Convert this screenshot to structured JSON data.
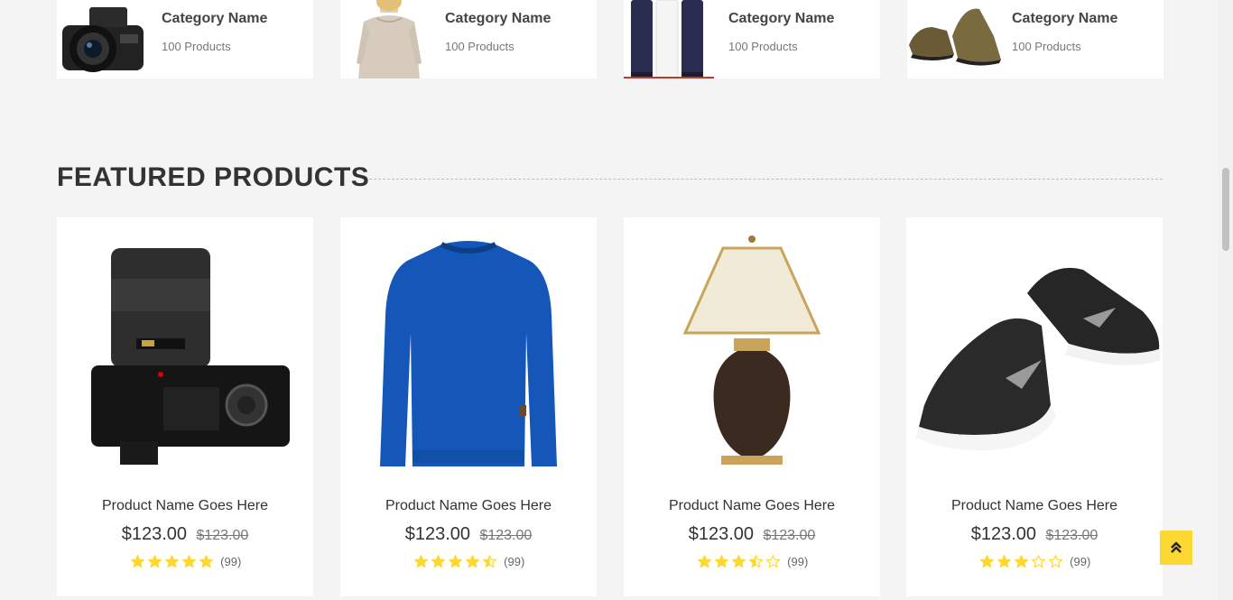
{
  "categories": [
    {
      "name": "Category Name",
      "count": "100 Products",
      "icon": "camera"
    },
    {
      "name": "Category Name",
      "count": "100 Products",
      "icon": "woman-sweater"
    },
    {
      "name": "Category Name",
      "count": "100 Products",
      "icon": "cosmetics"
    },
    {
      "name": "Category Name",
      "count": "100 Products",
      "icon": "shoes"
    }
  ],
  "featured": {
    "title": "FEATURED PRODUCTS",
    "products": [
      {
        "name": "Product Name Goes Here",
        "price": "$123.00",
        "old_price": "$123.00",
        "rating": 5,
        "reviews": "(99)",
        "icon": "camera"
      },
      {
        "name": "Product Name Goes Here",
        "price": "$123.00",
        "old_price": "$123.00",
        "rating": 4.5,
        "reviews": "(99)",
        "icon": "sweater"
      },
      {
        "name": "Product Name Goes Here",
        "price": "$123.00",
        "old_price": "$123.00",
        "rating": 3.5,
        "reviews": "(99)",
        "icon": "lamp"
      },
      {
        "name": "Product Name Goes Here",
        "price": "$123.00",
        "old_price": "$123.00",
        "rating": 3,
        "reviews": "(99)",
        "icon": "sneakers"
      }
    ]
  },
  "colors": {
    "accent": "#fdd835",
    "star": "#fdd835",
    "page_bg": "#f4f4f4"
  },
  "back_to_top_icon": "double-chevron-up-icon"
}
